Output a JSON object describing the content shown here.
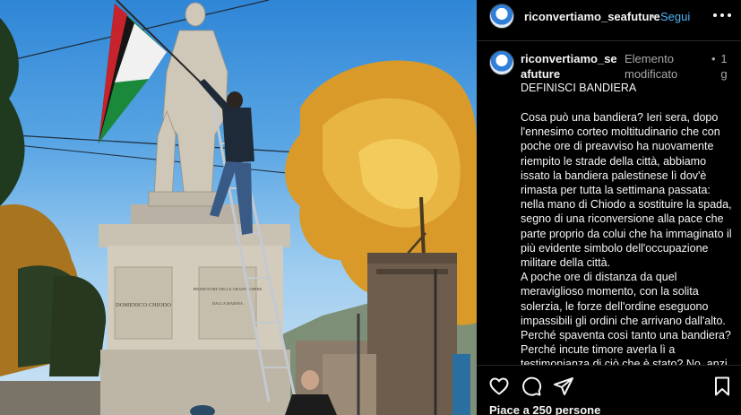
{
  "post": {
    "username": "riconvertiamo_seafuture",
    "follow_label": "Segui",
    "separator": "•",
    "more_icon": "more-options-icon"
  },
  "photo": {
    "pedestal_inscription": "DOMENICO CHIODO",
    "plaque_lines": [
      "PROMOTORE DELLE GRANDI OPERE",
      "DALLA MARINA"
    ]
  },
  "caption": {
    "username": "riconvertiamo_seafuture",
    "edited_label": "Elemento modificato",
    "separator": "•",
    "time": "1 g",
    "title": "DEFINISCI BANDIERA",
    "paragraphs": [
      "Cosa può una bandiera? Ieri sera, dopo l'ennesimo corteo moltitudinario che con poche ore di preavviso ha nuovamente riempito le strade della città, abbiamo issato la bandiera palestinese lì dov'è rimasta per tutta la settimana passata: nella mano di Chiodo a sostituire la spada, segno di una riconversione alla pace che parte proprio da colui che ha immaginato il più evidente simbolo dell'occupazione militare della città.",
      "A poche ore di distanza da quel meraviglioso momento, con la solita solerzia, le forze dell'ordine eseguono impassibili gli ordini che arrivano dall'alto. Perché spaventa così tanto una bandiera? Perché incute timore averla lì a testimonianza di ciò che è stato? No, anzi"
    ]
  },
  "actions": {
    "like_icon": "heart-icon",
    "comment_icon": "comment-icon",
    "share_icon": "share-icon",
    "save_icon": "bookmark-icon"
  },
  "likes_text": "Piace a 250 persone",
  "colors": {
    "background": "#000000",
    "text": "#f5f5f5",
    "secondary_text": "#a8a8a8",
    "link": "#4cb5f9",
    "divider": "#262626"
  }
}
